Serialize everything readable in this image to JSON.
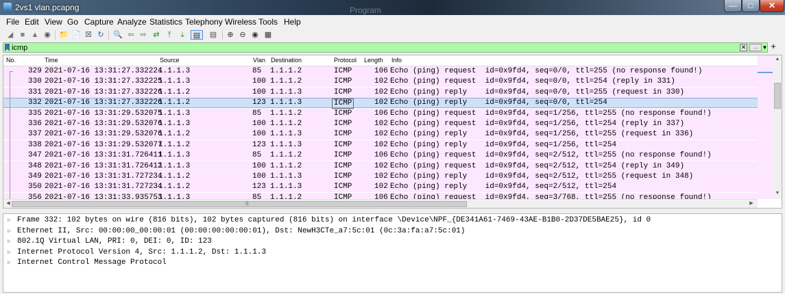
{
  "window": {
    "title": "2vs1 vlan.pcapng",
    "background_text": "Program"
  },
  "menu": [
    "File",
    "Edit",
    "View",
    "Go",
    "Capture",
    "Analyze",
    "Statistics",
    "Telephony",
    "Wireless",
    "Tools",
    "Help"
  ],
  "filter": {
    "value": "icmp",
    "clear_label": "✕",
    "apply_label": "→",
    "plus_label": "+"
  },
  "columns": [
    "No.",
    "Time",
    "Source",
    "Vlan",
    "Destination",
    "Protocol",
    "Length",
    "Info"
  ],
  "packets": [
    {
      "no": "329",
      "time": "2021-07-16 13:31:27.332224",
      "source": "1.1.1.3",
      "vlan": "85",
      "destination": "1.1.1.2",
      "protocol": "ICMP",
      "length": "106",
      "info": "Echo (ping) request  id=0x9fd4, seq=0/0, ttl=255 (no response found!)"
    },
    {
      "no": "330",
      "time": "2021-07-16 13:31:27.332225",
      "source": "1.1.1.3",
      "vlan": "100",
      "destination": "1.1.1.2",
      "protocol": "ICMP",
      "length": "102",
      "info": "Echo (ping) request  id=0x9fd4, seq=0/0, ttl=254 (reply in 331)"
    },
    {
      "no": "331",
      "time": "2021-07-16 13:31:27.332226",
      "source": "1.1.1.2",
      "vlan": "100",
      "destination": "1.1.1.3",
      "protocol": "ICMP",
      "length": "102",
      "info": "Echo (ping) reply    id=0x9fd4, seq=0/0, ttl=255 (request in 330)"
    },
    {
      "no": "332",
      "time": "2021-07-16 13:31:27.332226",
      "source": "1.1.1.2",
      "vlan": "123",
      "destination": "1.1.1.3",
      "protocol": "ICMP",
      "length": "102",
      "info": "Echo (ping) reply    id=0x9fd4, seq=0/0, ttl=254",
      "selected": true
    },
    {
      "no": "335",
      "time": "2021-07-16 13:31:29.532075",
      "source": "1.1.1.3",
      "vlan": "85",
      "destination": "1.1.1.2",
      "protocol": "ICMP",
      "length": "106",
      "info": "Echo (ping) request  id=0x9fd4, seq=1/256, ttl=255 (no response found!)"
    },
    {
      "no": "336",
      "time": "2021-07-16 13:31:29.532076",
      "source": "1.1.1.3",
      "vlan": "100",
      "destination": "1.1.1.2",
      "protocol": "ICMP",
      "length": "102",
      "info": "Echo (ping) request  id=0x9fd4, seq=1/256, ttl=254 (reply in 337)"
    },
    {
      "no": "337",
      "time": "2021-07-16 13:31:29.532076",
      "source": "1.1.1.2",
      "vlan": "100",
      "destination": "1.1.1.3",
      "protocol": "ICMP",
      "length": "102",
      "info": "Echo (ping) reply    id=0x9fd4, seq=1/256, ttl=255 (request in 336)"
    },
    {
      "no": "338",
      "time": "2021-07-16 13:31:29.532077",
      "source": "1.1.1.2",
      "vlan": "123",
      "destination": "1.1.1.3",
      "protocol": "ICMP",
      "length": "102",
      "info": "Echo (ping) reply    id=0x9fd4, seq=1/256, ttl=254"
    },
    {
      "no": "347",
      "time": "2021-07-16 13:31:31.726411",
      "source": "1.1.1.3",
      "vlan": "85",
      "destination": "1.1.1.2",
      "protocol": "ICMP",
      "length": "106",
      "info": "Echo (ping) request  id=0x9fd4, seq=2/512, ttl=255 (no response found!)"
    },
    {
      "no": "348",
      "time": "2021-07-16 13:31:31.726412",
      "source": "1.1.1.3",
      "vlan": "100",
      "destination": "1.1.1.2",
      "protocol": "ICMP",
      "length": "102",
      "info": "Echo (ping) request  id=0x9fd4, seq=2/512, ttl=254 (reply in 349)"
    },
    {
      "no": "349",
      "time": "2021-07-16 13:31:31.727234",
      "source": "1.1.1.2",
      "vlan": "100",
      "destination": "1.1.1.3",
      "protocol": "ICMP",
      "length": "102",
      "info": "Echo (ping) reply    id=0x9fd4, seq=2/512, ttl=255 (request in 348)"
    },
    {
      "no": "350",
      "time": "2021-07-16 13:31:31.727234",
      "source": "1.1.1.2",
      "vlan": "123",
      "destination": "1.1.1.3",
      "protocol": "ICMP",
      "length": "102",
      "info": "Echo (ping) reply    id=0x9fd4, seq=2/512, ttl=254"
    },
    {
      "no": "356",
      "time": "2021-07-16 13:31:33.935753",
      "source": "1.1.1.3",
      "vlan": "85",
      "destination": "1.1.1.2",
      "protocol": "ICMP",
      "length": "106",
      "info": "Echo (ping) request  id=0x9fd4, seq=3/768, ttl=255 (no response found!)"
    }
  ],
  "details": [
    "Frame 332: 102 bytes on wire (816 bits), 102 bytes captured (816 bits) on interface \\Device\\NPF_{DE341A61-7469-43AE-B1B0-2D37DE5BAE25}, id 0",
    "Ethernet II, Src: 00:00:00_00:00:01 (00:00:00:00:00:01), Dst: NewH3CTe_a7:5c:01 (0c:3a:fa:a7:5c:01)",
    "802.1Q Virtual LAN, PRI: 0, DEI: 0, ID: 123",
    "Internet Protocol Version 4, Src: 1.1.1.2, Dst: 1.1.1.3",
    "Internet Control Message Protocol"
  ],
  "colors": {
    "row_bg": "#fde6ff",
    "selected_bg": "#cfe0f7",
    "filter_bg": "#aff9a8"
  }
}
